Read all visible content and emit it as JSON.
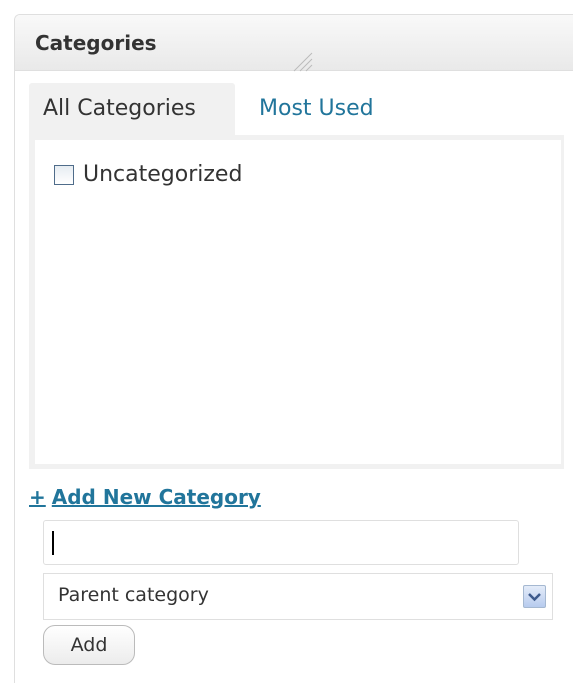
{
  "colors": {
    "link": "#21759b",
    "text": "#333333",
    "panel_bg": "#f1f1f1",
    "border": "#dfdfdf"
  },
  "postbox": {
    "title": "Categories"
  },
  "tabs": [
    {
      "label": "All Categories",
      "active": true
    },
    {
      "label": "Most Used",
      "active": false
    }
  ],
  "categories": [
    {
      "label": "Uncategorized",
      "checked": false
    }
  ],
  "add_new": {
    "icon": "+",
    "label": "Add New Category",
    "input_value": "",
    "parent_select": {
      "selected": "Parent category",
      "icon": "chevron-down-icon"
    },
    "submit_label": "Add"
  }
}
